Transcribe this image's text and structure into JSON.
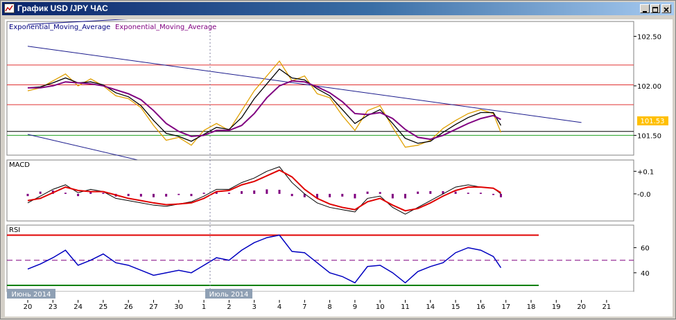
{
  "window": {
    "title": "График USD /JPY  ЧАС",
    "buttons": [
      "minimize",
      "maximize",
      "close"
    ]
  },
  "chart_data": [
    {
      "panel": "price",
      "type": "line",
      "title": "",
      "legend": [
        "Exponential_Moving_Average",
        "Exponential_Moving_Average"
      ],
      "ylim": [
        101.3,
        102.65
      ],
      "yticks": [
        101.5,
        102.0,
        102.5
      ],
      "ytick_labels": [
        "101.50",
        "102.00",
        "102.50"
      ],
      "current_price_label": "101.53",
      "current_price": 101.53,
      "horizontal_levels": [
        {
          "value": 102.21,
          "color": "#e03030"
        },
        {
          "value": 102.01,
          "color": "#e03030"
        },
        {
          "value": 101.81,
          "color": "#e03030"
        },
        {
          "value": 101.54,
          "color": "#000000"
        },
        {
          "value": 101.5,
          "color": "#20a020"
        },
        {
          "value": 101.21,
          "color": "#20a020"
        }
      ],
      "trend_lines": [
        {
          "from": [
            0,
            102.62
          ],
          "to": [
            22,
            102.92
          ],
          "color": "#1a1a8c"
        },
        {
          "from": [
            0,
            102.4
          ],
          "to": [
            22,
            101.63
          ],
          "color": "#1a1a8c"
        },
        {
          "from": [
            0,
            101.51
          ],
          "to": [
            7.6,
            101.06
          ],
          "color": "#1a1a8c"
        }
      ],
      "series": [
        {
          "name": "",
          "color": "#e0a000",
          "x": [
            0,
            0.5,
            1,
            1.5,
            2,
            2.5,
            3,
            3.5,
            4,
            4.5,
            5,
            5.5,
            6,
            6.5,
            7,
            7.5,
            8,
            8.5,
            9,
            9.5,
            10,
            10.5,
            11,
            11.5,
            12,
            12.5,
            13,
            13.5,
            14,
            14.5,
            15,
            15.5,
            16,
            16.5,
            17,
            17.5,
            18,
            18.5,
            18.8
          ],
          "values": [
            101.95,
            101.98,
            102.05,
            102.12,
            102.0,
            102.07,
            102.0,
            101.9,
            101.87,
            101.78,
            101.6,
            101.45,
            101.48,
            101.4,
            101.55,
            101.62,
            101.55,
            101.75,
            101.95,
            102.1,
            102.25,
            102.05,
            102.1,
            101.92,
            101.88,
            101.7,
            101.55,
            101.75,
            101.8,
            101.58,
            101.38,
            101.4,
            101.45,
            101.57,
            101.65,
            101.72,
            101.76,
            101.72,
            101.53
          ]
        },
        {
          "name": "",
          "color": "#000000",
          "x": [
            0,
            0.5,
            1,
            1.5,
            2,
            2.5,
            3,
            3.5,
            4,
            4.5,
            5,
            5.5,
            6,
            6.5,
            7,
            7.5,
            8,
            8.5,
            9,
            9.5,
            10,
            10.5,
            11,
            11.5,
            12,
            12.5,
            13,
            13.5,
            14,
            14.5,
            15,
            15.5,
            16,
            16.5,
            17,
            17.5,
            18,
            18.5,
            18.8
          ],
          "values": [
            101.98,
            101.99,
            102.03,
            102.08,
            102.03,
            102.04,
            102.01,
            101.93,
            101.89,
            101.8,
            101.65,
            101.52,
            101.49,
            101.44,
            101.51,
            101.58,
            101.56,
            101.68,
            101.87,
            102.02,
            102.17,
            102.08,
            102.06,
            101.97,
            101.9,
            101.76,
            101.62,
            101.7,
            101.76,
            101.62,
            101.47,
            101.42,
            101.44,
            101.53,
            101.61,
            101.68,
            101.73,
            101.73,
            101.6
          ]
        },
        {
          "name": "",
          "color": "#800080",
          "x": [
            0,
            0.5,
            1,
            1.5,
            2,
            2.5,
            3,
            3.5,
            4,
            4.5,
            5,
            5.5,
            6,
            6.5,
            7,
            7.5,
            8,
            8.5,
            9,
            9.5,
            10,
            10.5,
            11,
            11.5,
            12,
            12.5,
            13,
            13.5,
            14,
            14.5,
            15,
            15.5,
            16,
            16.5,
            17,
            17.5,
            18,
            18.5,
            18.8
          ],
          "values": [
            101.98,
            101.98,
            102.0,
            102.04,
            102.03,
            102.02,
            102.0,
            101.96,
            101.92,
            101.86,
            101.75,
            101.62,
            101.54,
            101.49,
            101.5,
            101.55,
            101.55,
            101.6,
            101.72,
            101.88,
            102.0,
            102.05,
            102.04,
            101.99,
            101.93,
            101.84,
            101.72,
            101.71,
            101.73,
            101.67,
            101.56,
            101.48,
            101.46,
            101.5,
            101.56,
            101.62,
            101.67,
            101.7,
            101.66
          ]
        }
      ]
    },
    {
      "panel": "macd",
      "type": "line",
      "label": "MACD",
      "ylim": [
        -0.12,
        0.15
      ],
      "yticks": [
        0.1,
        0.0
      ],
      "ytick_labels": [
        "+0.1",
        "-0.0"
      ],
      "histogram": {
        "color": "#800080",
        "x": [
          0,
          0.5,
          1,
          1.5,
          2,
          2.5,
          3,
          3.5,
          4,
          4.5,
          5,
          5.5,
          6,
          6.5,
          7,
          7.5,
          8,
          8.5,
          9,
          9.5,
          10,
          10.5,
          11,
          11.5,
          12,
          12.5,
          13,
          13.5,
          14,
          14.5,
          15,
          15.5,
          16,
          16.5,
          17,
          17.5,
          18,
          18.5,
          18.8
        ],
        "values": [
          -0.01,
          0.01,
          0.015,
          0.005,
          -0.01,
          0.01,
          0.005,
          -0.012,
          -0.01,
          -0.012,
          -0.015,
          -0.012,
          -0.005,
          -0.01,
          0.005,
          0.01,
          0.005,
          0.012,
          0.015,
          0.02,
          0.018,
          -0.01,
          -0.015,
          -0.02,
          -0.015,
          -0.012,
          -0.02,
          0.01,
          0.008,
          -0.02,
          -0.02,
          0.01,
          0.012,
          0.012,
          0.01,
          0.005,
          0.005,
          -0.005,
          -0.015
        ]
      },
      "series": [
        {
          "name": "",
          "color": "#000000",
          "x": [
            0,
            0.5,
            1,
            1.5,
            2,
            2.5,
            3,
            3.5,
            4,
            4.5,
            5,
            5.5,
            6,
            6.5,
            7,
            7.5,
            8,
            8.5,
            9,
            9.5,
            10,
            10.5,
            11,
            11.5,
            12,
            12.5,
            13,
            13.5,
            14,
            14.5,
            15,
            15.5,
            16,
            16.5,
            17,
            17.5,
            18,
            18.5,
            18.8
          ],
          "values": [
            -0.04,
            -0.01,
            0.02,
            0.04,
            0.005,
            0.02,
            0.01,
            -0.02,
            -0.03,
            -0.04,
            -0.05,
            -0.055,
            -0.045,
            -0.035,
            -0.01,
            0.02,
            0.02,
            0.05,
            0.07,
            0.1,
            0.12,
            0.05,
            0.0,
            -0.04,
            -0.06,
            -0.07,
            -0.08,
            -0.02,
            -0.01,
            -0.06,
            -0.09,
            -0.06,
            -0.03,
            0.0,
            0.03,
            0.04,
            0.03,
            0.025,
            0.0
          ]
        },
        {
          "name": "",
          "color": "#e00000",
          "x": [
            0,
            0.5,
            1,
            1.5,
            2,
            2.5,
            3,
            3.5,
            4,
            4.5,
            5,
            5.5,
            6,
            6.5,
            7,
            7.5,
            8,
            8.5,
            9,
            9.5,
            10,
            10.5,
            11,
            11.5,
            12,
            12.5,
            13,
            13.5,
            14,
            14.5,
            15,
            15.5,
            16,
            16.5,
            17,
            17.5,
            18,
            18.5,
            18.8
          ],
          "values": [
            -0.03,
            -0.02,
            0.005,
            0.03,
            0.015,
            0.01,
            0.01,
            -0.005,
            -0.02,
            -0.03,
            -0.04,
            -0.048,
            -0.045,
            -0.04,
            -0.02,
            0.01,
            0.015,
            0.04,
            0.055,
            0.08,
            0.105,
            0.075,
            0.02,
            -0.02,
            -0.045,
            -0.06,
            -0.07,
            -0.035,
            -0.02,
            -0.05,
            -0.075,
            -0.065,
            -0.04,
            -0.01,
            0.015,
            0.03,
            0.03,
            0.025,
            0.005
          ]
        }
      ]
    },
    {
      "panel": "rsi",
      "type": "line",
      "label": "RSI",
      "ylim": [
        25,
        78
      ],
      "yticks": [
        60,
        40
      ],
      "ytick_labels": [
        "60",
        "40"
      ],
      "levels": [
        {
          "value": 70,
          "color": "#e00000"
        },
        {
          "value": 50,
          "color": "#800080"
        },
        {
          "value": 30,
          "color": "#008000"
        }
      ],
      "series": [
        {
          "name": "",
          "color": "#0000c0",
          "x": [
            0,
            0.5,
            1,
            1.5,
            2,
            2.5,
            3,
            3.5,
            4,
            4.5,
            5,
            5.5,
            6,
            6.5,
            7,
            7.5,
            8,
            8.5,
            9,
            9.5,
            10,
            10.5,
            11,
            11.5,
            12,
            12.5,
            13,
            13.5,
            14,
            14.5,
            15,
            15.5,
            16,
            16.5,
            17,
            17.5,
            18,
            18.5,
            18.8
          ],
          "values": [
            43,
            47,
            52,
            58,
            46,
            50,
            55,
            48,
            46,
            42,
            38,
            40,
            42,
            40,
            46,
            52,
            50,
            58,
            64,
            68,
            70,
            57,
            56,
            48,
            40,
            37,
            32,
            45,
            46,
            40,
            32,
            41,
            45,
            48,
            56,
            60,
            58,
            53,
            44
          ]
        }
      ]
    }
  ],
  "x_axis": {
    "ticks": [
      "20",
      "23",
      "24",
      "25",
      "26",
      "27",
      "30",
      "1",
      "2",
      "3",
      "4",
      "7",
      "8",
      "9",
      "10",
      "11",
      "14",
      "15",
      "16",
      "17",
      "18",
      "19",
      "20",
      "21"
    ],
    "month_labels": [
      "Июнь 2014",
      "Июль 2014"
    ]
  }
}
